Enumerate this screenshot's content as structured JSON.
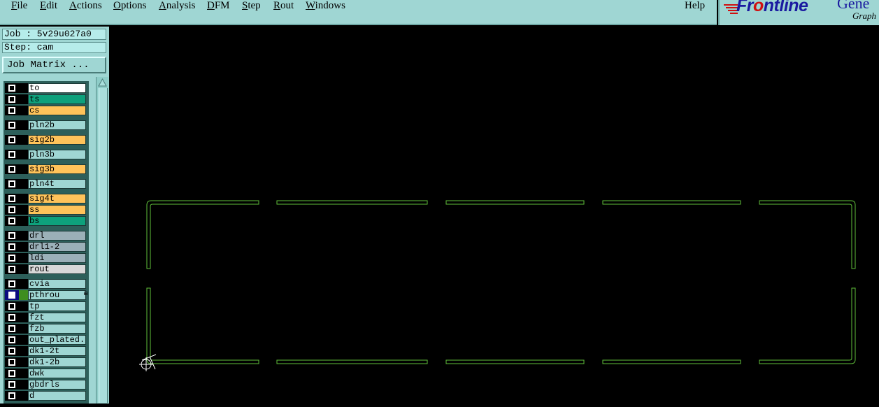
{
  "menu": {
    "file": "File",
    "edit": "Edit",
    "actions": "Actions",
    "options": "Options",
    "analysis": "Analysis",
    "dfm": "DFM",
    "step": "Step",
    "rout": "Rout",
    "windows": "Windows",
    "help": "Help"
  },
  "logo": {
    "brand_a": "Fr",
    "brand_o": "o",
    "brand_b": "ntline",
    "product": "Gene",
    "tagline": "Graph"
  },
  "job_info": {
    "job": "Job : 5v29u027a0",
    "step": "Step: cam",
    "matrix_button": "Job Matrix ..."
  },
  "layers": [
    {
      "name": "to",
      "color": "#ffffff"
    },
    {
      "name": "ts",
      "color": "#0ea17c"
    },
    {
      "name": "cs",
      "color": "#ffc35a"
    },
    {
      "name": "pln2b",
      "color": "#9fd6d3"
    },
    {
      "name": "sig2b",
      "color": "#ffc35a"
    },
    {
      "name": "pln3b",
      "color": "#9fd6d3"
    },
    {
      "name": "sig3b",
      "color": "#ffc35a"
    },
    {
      "name": "pln4t",
      "color": "#9fd6d3"
    },
    {
      "name": "sig4t",
      "color": "#ffc35a"
    },
    {
      "name": "ss",
      "color": "#ffc35a"
    },
    {
      "name": "bs",
      "color": "#0ea17c"
    },
    {
      "name": "drl",
      "color": "#9bb0b8"
    },
    {
      "name": "drl1-2",
      "color": "#9bb0b8"
    },
    {
      "name": "ldi",
      "color": "#9bb0b8"
    },
    {
      "name": "rout",
      "color": "#d8d8d8"
    },
    {
      "name": "cvia",
      "color": "#9fd6d3"
    },
    {
      "name": "pthrou",
      "color": "#9fd6d3",
      "selected": true
    },
    {
      "name": "tp",
      "color": "#9fd6d3"
    },
    {
      "name": "fzt",
      "color": "#9fd6d3"
    },
    {
      "name": "fzb",
      "color": "#9fd6d3"
    },
    {
      "name": "out_plated.c",
      "color": "#9fd6d3"
    },
    {
      "name": "dk1-2t",
      "color": "#9fd6d3"
    },
    {
      "name": "dk1-2b",
      "color": "#9fd6d3"
    },
    {
      "name": "dwk",
      "color": "#9fd6d3"
    },
    {
      "name": "gbdrls",
      "color": "#9fd6d3"
    },
    {
      "name": "d",
      "color": "#9fd6d3"
    }
  ],
  "graphics": {
    "outline_color": "#5fbf3a",
    "cursor_color": "#ffffff"
  }
}
